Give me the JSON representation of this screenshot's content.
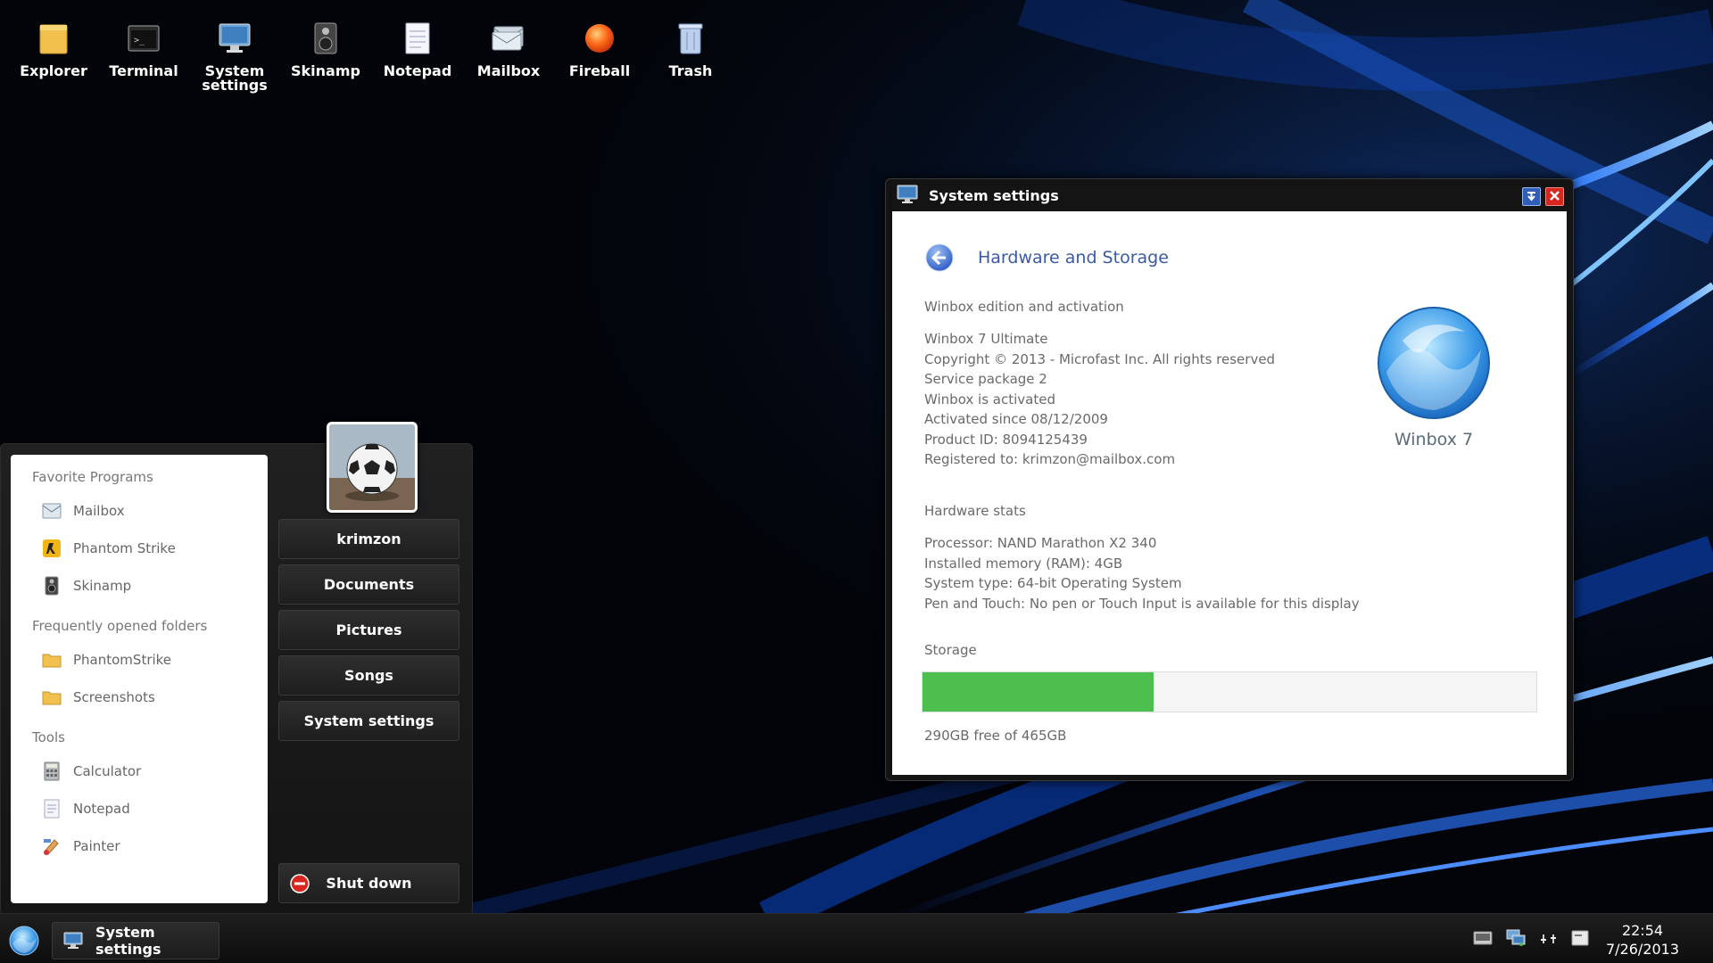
{
  "desktop_icons": [
    {
      "label": "Explorer",
      "icon": "folder-icon"
    },
    {
      "label": "Terminal",
      "icon": "terminal-icon"
    },
    {
      "label": "System\nsettings",
      "icon": "monitor-icon"
    },
    {
      "label": "Skinamp",
      "icon": "speaker-icon"
    },
    {
      "label": "Notepad",
      "icon": "notepad-icon"
    },
    {
      "label": "Mailbox",
      "icon": "mail-icon"
    },
    {
      "label": "Fireball",
      "icon": "fireball-icon"
    },
    {
      "label": "Trash",
      "icon": "trash-icon"
    }
  ],
  "start_menu": {
    "sections": {
      "favorites": "Favorite Programs",
      "folders": "Frequently opened folders",
      "tools": "Tools"
    },
    "favorites": [
      {
        "label": "Mailbox",
        "icon": "mail-icon"
      },
      {
        "label": "Phantom Strike",
        "icon": "game-icon"
      },
      {
        "label": "Skinamp",
        "icon": "speaker-icon"
      }
    ],
    "folders": [
      {
        "label": "PhantomStrike",
        "icon": "folder-icon"
      },
      {
        "label": "Screenshots",
        "icon": "folder-icon"
      }
    ],
    "tools": [
      {
        "label": "Calculator",
        "icon": "calculator-icon"
      },
      {
        "label": "Notepad",
        "icon": "notepad-icon"
      },
      {
        "label": "Painter",
        "icon": "paint-icon"
      }
    ],
    "buttons": {
      "user": "krimzon",
      "documents": "Documents",
      "pictures": "Pictures",
      "songs": "Songs",
      "system_settings": "System settings",
      "shutdown": "Shut down"
    }
  },
  "settings_window": {
    "title": "System settings",
    "heading": "Hardware and Storage",
    "edition_section": "Winbox edition and activation",
    "edition_lines": [
      "Winbox 7 Ultimate",
      "Copyright © 2013 - Microfast Inc. All rights reserved",
      "Service package 2",
      "Winbox is activated",
      "Activated since 08/12/2009",
      "Product ID: 8094125439",
      "Registered to: krimzon@mailbox.com"
    ],
    "logo_label": "Winbox 7",
    "hardware_section": "Hardware stats",
    "hardware_lines": [
      "Processor: NAND Marathon X2 340",
      "Installed memory (RAM): 4GB",
      "System type: 64-bit Operating System",
      "Pen and Touch: No pen or Touch Input is available for this display"
    ],
    "storage_section": "Storage",
    "storage_used_fraction": 0.376,
    "storage_text": "290GB free of 465GB"
  },
  "taskbar": {
    "active_task": "System settings",
    "time": "22:54",
    "date": "7/26/2013"
  },
  "colors": {
    "accent_blue": "#3a6fd1",
    "storage_green": "#4dbf4f",
    "close_red": "#d7261e"
  }
}
